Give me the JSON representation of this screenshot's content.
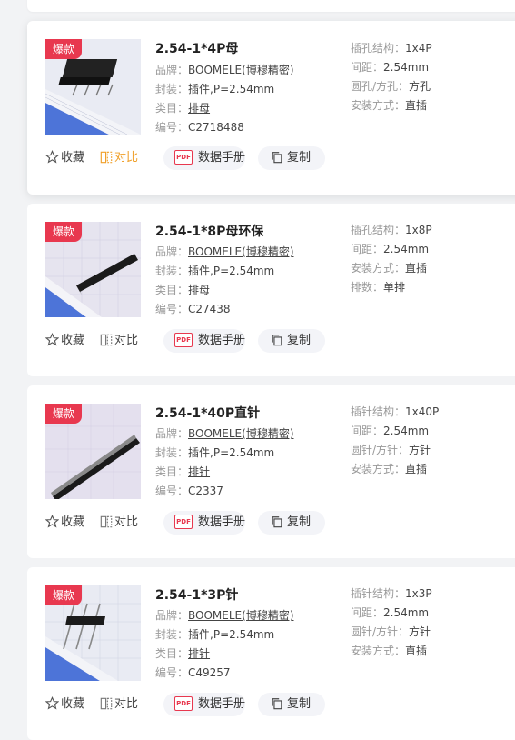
{
  "products": [
    {
      "badge": "爆款",
      "title": "2.54-1*4P母",
      "brand_label": "品牌：",
      "brand": "BOOMELE(博穆精密)",
      "package_label": "封装：",
      "package": "插件,P=2.54mm",
      "category_label": "类目：",
      "category": "排母",
      "code_label": "编号：",
      "code": "C2718488",
      "specs": [
        {
          "label": "插孔结构：",
          "value": "1x4P"
        },
        {
          "label": "间距：",
          "value": "2.54mm"
        },
        {
          "label": "圆孔/方孔：",
          "value": "方孔"
        },
        {
          "label": "安装方式：",
          "value": "直插"
        }
      ],
      "favorite_label": "收藏",
      "compare_label": "对比",
      "datasheet_label": "数据手册",
      "copy_label": "复制",
      "pdf_text": "PDF"
    },
    {
      "badge": "爆款",
      "title": "2.54-1*8P母环保",
      "brand_label": "品牌：",
      "brand": "BOOMELE(博穆精密)",
      "package_label": "封装：",
      "package": "插件,P=2.54mm",
      "category_label": "类目：",
      "category": "排母",
      "code_label": "编号：",
      "code": "C27438",
      "specs": [
        {
          "label": "插孔结构：",
          "value": "1x8P"
        },
        {
          "label": "间距：",
          "value": "2.54mm"
        },
        {
          "label": "安装方式：",
          "value": "直插"
        },
        {
          "label": "排数：",
          "value": "单排"
        }
      ],
      "favorite_label": "收藏",
      "compare_label": "对比",
      "datasheet_label": "数据手册",
      "copy_label": "复制",
      "pdf_text": "PDF"
    },
    {
      "badge": "爆款",
      "title": "2.54-1*40P直针",
      "brand_label": "品牌：",
      "brand": "BOOMELE(博穆精密)",
      "package_label": "封装：",
      "package": "插件,P=2.54mm",
      "category_label": "类目：",
      "category": "排针",
      "code_label": "编号：",
      "code": "C2337",
      "specs": [
        {
          "label": "插针结构：",
          "value": "1x40P"
        },
        {
          "label": "间距：",
          "value": "2.54mm"
        },
        {
          "label": "圆针/方针：",
          "value": "方针"
        },
        {
          "label": "安装方式：",
          "value": "直插"
        }
      ],
      "favorite_label": "收藏",
      "compare_label": "对比",
      "datasheet_label": "数据手册",
      "copy_label": "复制",
      "pdf_text": "PDF"
    },
    {
      "badge": "爆款",
      "title": "2.54-1*3P针",
      "brand_label": "品牌：",
      "brand": "BOOMELE(博穆精密)",
      "package_label": "封装：",
      "package": "插件,P=2.54mm",
      "category_label": "类目：",
      "category": "排针",
      "code_label": "编号：",
      "code": "C49257",
      "specs": [
        {
          "label": "插针结构：",
          "value": "1x3P"
        },
        {
          "label": "间距：",
          "value": "2.54mm"
        },
        {
          "label": "圆针/方针：",
          "value": "方针"
        },
        {
          "label": "安装方式：",
          "value": "直插"
        }
      ],
      "favorite_label": "收藏",
      "compare_label": "对比",
      "datasheet_label": "数据手册",
      "copy_label": "复制",
      "pdf_text": "PDF"
    }
  ],
  "colors": {
    "badge": "#e8384f",
    "compare_active": "#f0a02a",
    "pdf": "#e8384f"
  }
}
